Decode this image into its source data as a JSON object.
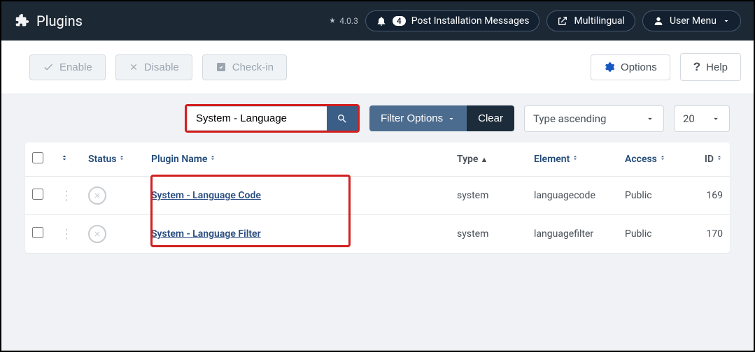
{
  "header": {
    "title": "Plugins",
    "version": "4.0.3",
    "notifications_count": "4",
    "post_install": "Post Installation Messages",
    "multilingual": "Multilingual",
    "user_menu": "User Menu"
  },
  "toolbar": {
    "enable": "Enable",
    "disable": "Disable",
    "checkin": "Check-in",
    "options": "Options",
    "help": "Help"
  },
  "filters": {
    "search_value": "System - Language",
    "filter_options": "Filter Options",
    "clear": "Clear",
    "sort": "Type ascending",
    "pagesize": "20"
  },
  "columns": {
    "status": "Status",
    "plugin_name": "Plugin Name",
    "type": "Type",
    "element": "Element",
    "access": "Access",
    "id": "ID"
  },
  "rows": [
    {
      "name": "System - Language Code",
      "type": "system",
      "element": "languagecode",
      "access": "Public",
      "id": "169"
    },
    {
      "name": "System - Language Filter",
      "type": "system",
      "element": "languagefilter",
      "access": "Public",
      "id": "170"
    }
  ]
}
